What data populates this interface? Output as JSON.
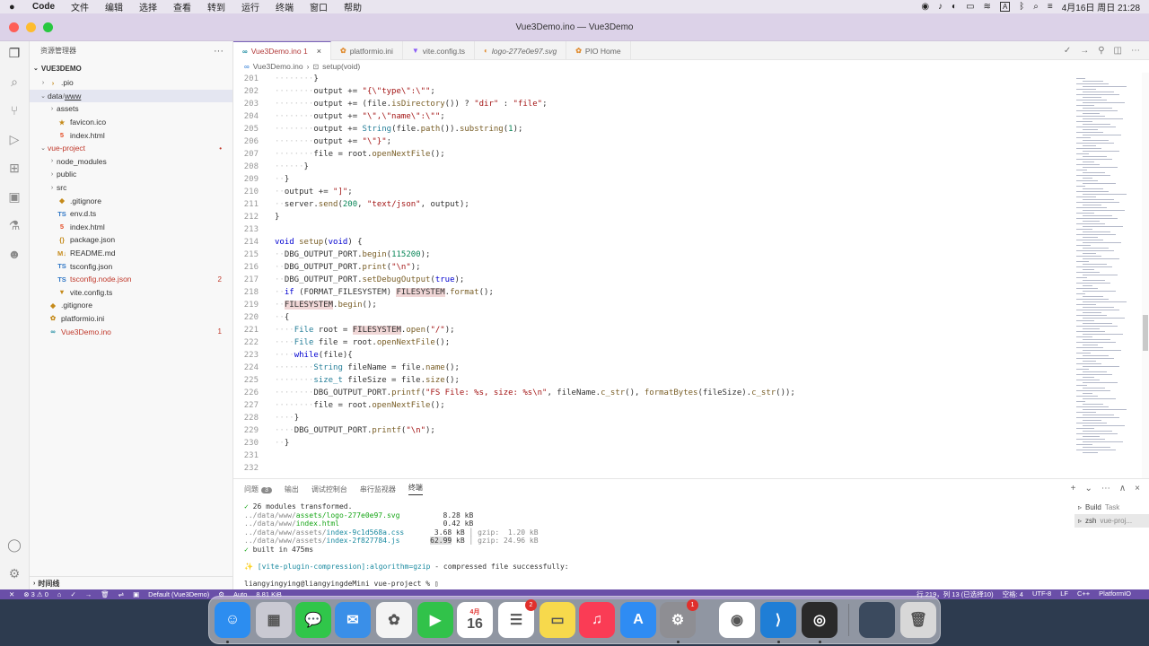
{
  "menubar": {
    "app": "Code",
    "items": [
      "文件",
      "编辑",
      "选择",
      "查看",
      "转到",
      "运行",
      "终端",
      "窗口",
      "帮助"
    ],
    "tray_text": "A",
    "datetime": "4月16日 周日 21:28"
  },
  "window": {
    "title": "Vue3Demo.ino — Vue3Demo"
  },
  "sidebar": {
    "header": "资源管理器",
    "more": "···",
    "section": "VUE3DEMO",
    "timeline": "时间线",
    "tree": [
      {
        "label": ".pio",
        "chev": "›",
        "icon": "›",
        "indent": 1
      },
      {
        "label": "data",
        "label2": "www",
        "chev": "⌄",
        "icon": "",
        "indent": 1,
        "selected": true
      },
      {
        "label": "assets",
        "chev": "›",
        "icon": "",
        "indent": 2
      },
      {
        "label": "favicon.ico",
        "chev": "",
        "icon": "★",
        "indent": 2
      },
      {
        "label": "index.html",
        "chev": "",
        "icon": "5",
        "indent": 2
      },
      {
        "label": "vue-project",
        "chev": "⌄",
        "icon": "",
        "indent": 1,
        "color": "#c0392b",
        "badge": "•"
      },
      {
        "label": "node_modules",
        "chev": "›",
        "icon": "",
        "indent": 2
      },
      {
        "label": "public",
        "chev": "›",
        "icon": "",
        "indent": 2
      },
      {
        "label": "src",
        "chev": "›",
        "icon": "",
        "indent": 2
      },
      {
        "label": ".gitignore",
        "chev": "",
        "icon": "◆",
        "indent": 2
      },
      {
        "label": "env.d.ts",
        "chev": "",
        "icon": "TS",
        "indent": 2
      },
      {
        "label": "index.html",
        "chev": "",
        "icon": "5",
        "indent": 2
      },
      {
        "label": "package.json",
        "chev": "",
        "icon": "{}",
        "indent": 2
      },
      {
        "label": "README.md",
        "chev": "",
        "icon": "M↓",
        "indent": 2
      },
      {
        "label": "tsconfig.json",
        "chev": "",
        "icon": "TS",
        "indent": 2
      },
      {
        "label": "tsconfig.node.json",
        "chev": "",
        "icon": "TS",
        "indent": 2,
        "color": "#c0392b",
        "badge": "2"
      },
      {
        "label": "vite.config.ts",
        "chev": "",
        "icon": "▼",
        "indent": 2
      },
      {
        "label": ".gitignore",
        "chev": "",
        "icon": "◆",
        "indent": 1
      },
      {
        "label": "platformio.ini",
        "chev": "",
        "icon": "✿",
        "indent": 1
      },
      {
        "label": "Vue3Demo.ino",
        "chev": "",
        "icon": "∞",
        "indent": 1,
        "color": "#c0392b",
        "badge": "1"
      }
    ]
  },
  "tabs": [
    {
      "label": "Vue3Demo.ino 1",
      "icon": "∞",
      "active": true,
      "close": "×"
    },
    {
      "label": "platformio.ini",
      "icon": "✿"
    },
    {
      "label": "vite.config.ts",
      "icon": "▼"
    },
    {
      "label": "logo-277e0e97.svg",
      "icon": "◐",
      "italic": true
    },
    {
      "label": "PIO Home",
      "icon": "✿"
    }
  ],
  "breadcrumb": {
    "file": "Vue3Demo.ino",
    "sep": "›",
    "symbol": "setup(void)"
  },
  "code_lines": [
    {
      "n": "201",
      "html": "<span class='ws'>········</span>}"
    },
    {
      "n": "202",
      "html": "<span class='ws'>········</span>output += <span class='str'>\"{\\\"type\\\":\\\"\"</span>;"
    },
    {
      "n": "203",
      "html": "<span class='ws'>········</span>output += (file.<span class='fn'>isDirectory</span>()) ? <span class='str'>\"dir\"</span> : <span class='str'>\"file\"</span>;"
    },
    {
      "n": "204",
      "html": "<span class='ws'>········</span>output += <span class='str'>\"\\\",\\\"name\\\":\\\"\"</span>;"
    },
    {
      "n": "205",
      "html": "<span class='ws'>········</span>output += <span class='ty'>String</span>(file.<span class='fn'>path</span>()).<span class='fn'>substring</span>(<span class='num'>1</span>);"
    },
    {
      "n": "206",
      "html": "<span class='ws'>········</span>output += <span class='str'>\"\\\"}\"</span>;"
    },
    {
      "n": "207",
      "html": "<span class='ws'>········</span>file = root.<span class='fn'>openNextFile</span>();"
    },
    {
      "n": "208",
      "html": "<span class='ws'>······</span>}"
    },
    {
      "n": "209",
      "html": "<span class='ws'>··</span>}"
    },
    {
      "n": "210",
      "html": "<span class='ws'>··</span>output += <span class='str'>\"]\"</span>;"
    },
    {
      "n": "211",
      "html": "<span class='ws'>··</span>server.<span class='fn'>send</span>(<span class='num'>200</span>, <span class='str'>\"text/json\"</span>, output);"
    },
    {
      "n": "212",
      "html": "}"
    },
    {
      "n": "213",
      "html": ""
    },
    {
      "n": "214",
      "html": "<span class='kw'>void</span> <span class='fn'>setup</span>(<span class='kw'>void</span>) {"
    },
    {
      "n": "215",
      "html": "<span class='ws'>··</span>DBG_OUTPUT_PORT.<span class='fn'>begin</span>(<span class='num'>115200</span>);"
    },
    {
      "n": "216",
      "html": "<span class='ws'>··</span>DBG_OUTPUT_PORT.<span class='fn'>print</span>(<span class='str'>\"\\n\"</span>);"
    },
    {
      "n": "217",
      "html": "<span class='ws'>··</span>DBG_OUTPUT_PORT.<span class='fn'>setDebugOutput</span>(<span class='kw'>true</span>);"
    },
    {
      "n": "218",
      "html": "<span class='ws'>··</span><span class='kw'>if</span> (FORMAT_FILESYSTEM) <span class='hl'>FILESYSTEM</span>.<span class='fn'>format</span>();"
    },
    {
      "n": "219",
      "html": "<span class='ws'>··</span><span class='hl'>FILESYSTEM</span>.<span class='fn'>begin</span>();"
    },
    {
      "n": "220",
      "html": "<span class='ws'>··</span>{"
    },
    {
      "n": "221",
      "html": "<span class='ws'>····</span><span class='ty'>File</span> root = <span class='hl'>FILESYSTEM</span>.<span class='fn'>open</span>(<span class='str'>\"/\"</span>);"
    },
    {
      "n": "222",
      "html": "<span class='ws'>····</span><span class='ty'>File</span> file = root.<span class='fn'>openNextFile</span>();"
    },
    {
      "n": "223",
      "html": "<span class='ws'>····</span><span class='kw'>while</span>(file){"
    },
    {
      "n": "224",
      "html": "<span class='ws'>········</span><span class='ty'>String</span> fileName = file.<span class='fn'>name</span>();"
    },
    {
      "n": "225",
      "html": "<span class='ws'>········</span><span class='ty'>size_t</span> fileSize = file.<span class='fn'>size</span>();"
    },
    {
      "n": "226",
      "html": "<span class='ws'>········</span>DBG_OUTPUT_PORT.<span class='fn'>printf</span>(<span class='str'>\"FS File: %s, size: %s\\n\"</span>, fileName.<span class='fn'>c_str</span>(), <span class='fn'>formatBytes</span>(fileSize).<span class='fn'>c_str</span>());"
    },
    {
      "n": "227",
      "html": "<span class='ws'>········</span>file = root.<span class='fn'>openNextFile</span>();"
    },
    {
      "n": "228",
      "html": "<span class='ws'>····</span>}"
    },
    {
      "n": "229",
      "html": "<span class='ws'>····</span>DBG_OUTPUT_PORT.<span class='fn'>printf</span>(<span class='str'>\"\\n\"</span>);"
    },
    {
      "n": "230",
      "html": "<span class='ws'>··</span>}"
    },
    {
      "n": "231",
      "html": ""
    },
    {
      "n": "232",
      "html": ""
    }
  ],
  "panel": {
    "tabs": [
      {
        "label": "问题",
        "count": "3"
      },
      {
        "label": "输出"
      },
      {
        "label": "调试控制台"
      },
      {
        "label": "串行监视器"
      },
      {
        "label": "终端",
        "active": true
      }
    ],
    "actions": [
      "+",
      "⌄",
      "⋯",
      "∧",
      "×"
    ],
    "terminals": [
      {
        "label": "Build",
        "sub": "Task",
        "active": false
      },
      {
        "label": "zsh",
        "sub": "vue-proj...",
        "active": true
      }
    ]
  },
  "terminal_lines": [
    "<span class='t-green'>✓</span> 26 modules transformed.",
    "<span class='t-gray'>../data/www/</span><span class='t-green'>assets/logo-277e0e97.svg</span>          8.28 kB",
    "<span class='t-gray'>../data/www/</span><span class='t-green'>index.html</span>                        0.42 kB",
    "<span class='t-gray'>../data/www/assets/</span><span class='t-cyan'>index-9c1d568a.css</span>       3.68 kB <span class='t-gray'>│ gzip:  1.20 kB</span>",
    "<span class='t-gray'>../data/www/assets/</span><span class='t-cyan'>index-2f827784.js</span>       <span class='t-box'>62.99</span> kB <span class='t-gray'>│ gzip: 24.96 kB</span>",
    "<span class='t-green'>✓</span> built in 475ms",
    "",
    "<span style='color:#d4a017'>✨</span> <span class='t-cyan'>[vite-plugin-compression]:algorithm=gzip</span> - compressed file successfully:",
    "",
    "liangyingying@liangyingdeMini vue-project % ▯"
  ],
  "statusbar": {
    "left": [
      "✕",
      "⊗ 3 ⚠ 0",
      "⌂",
      "✓",
      "→",
      "🗑",
      "⇌",
      "▣",
      "Default (Vue3Demo)",
      "⚙",
      "Auto",
      "8.81 KiB"
    ],
    "right": [
      "行 219，列 13 (已选择10)",
      "空格: 4",
      "UTF-8",
      "LF",
      "C++",
      "PlatformIO"
    ]
  },
  "dock": [
    {
      "name": "finder",
      "glyph": "☺",
      "bg": "#2c8df0"
    },
    {
      "name": "launchpad",
      "glyph": "▦",
      "bg": "#c9c9d2"
    },
    {
      "name": "messages",
      "glyph": "💬",
      "bg": "#30c64a"
    },
    {
      "name": "mail",
      "glyph": "✉",
      "bg": "#3a8fe8"
    },
    {
      "name": "photos",
      "glyph": "✿",
      "bg": "#f4f4f4"
    },
    {
      "name": "facetime",
      "glyph": "▶",
      "bg": "#31c24a"
    },
    {
      "name": "calendar",
      "glyph": "16",
      "bg": "#ffffff",
      "sub": "4月"
    },
    {
      "name": "reminders",
      "glyph": "☰",
      "bg": "#ffffff",
      "badge": "2"
    },
    {
      "name": "notes",
      "glyph": "▭",
      "bg": "#f7d94c"
    },
    {
      "name": "music",
      "glyph": "♫",
      "bg": "#fa3c55"
    },
    {
      "name": "app-store",
      "glyph": "A",
      "bg": "#2f8cf3"
    },
    {
      "name": "system-settings",
      "glyph": "⚙",
      "bg": "#8e8e93",
      "badge": "1"
    },
    {
      "name": "chrome",
      "glyph": "◉",
      "bg": "#ffffff"
    },
    {
      "name": "vscode",
      "glyph": "⟩",
      "bg": "#1f7ed6"
    },
    {
      "name": "obs",
      "glyph": "◎",
      "bg": "#2a2a2a"
    },
    {
      "name": "window-preview",
      "glyph": "",
      "bg": "#3b4a5e"
    },
    {
      "name": "trash",
      "glyph": "🗑",
      "bg": "#d8d8d8"
    }
  ]
}
